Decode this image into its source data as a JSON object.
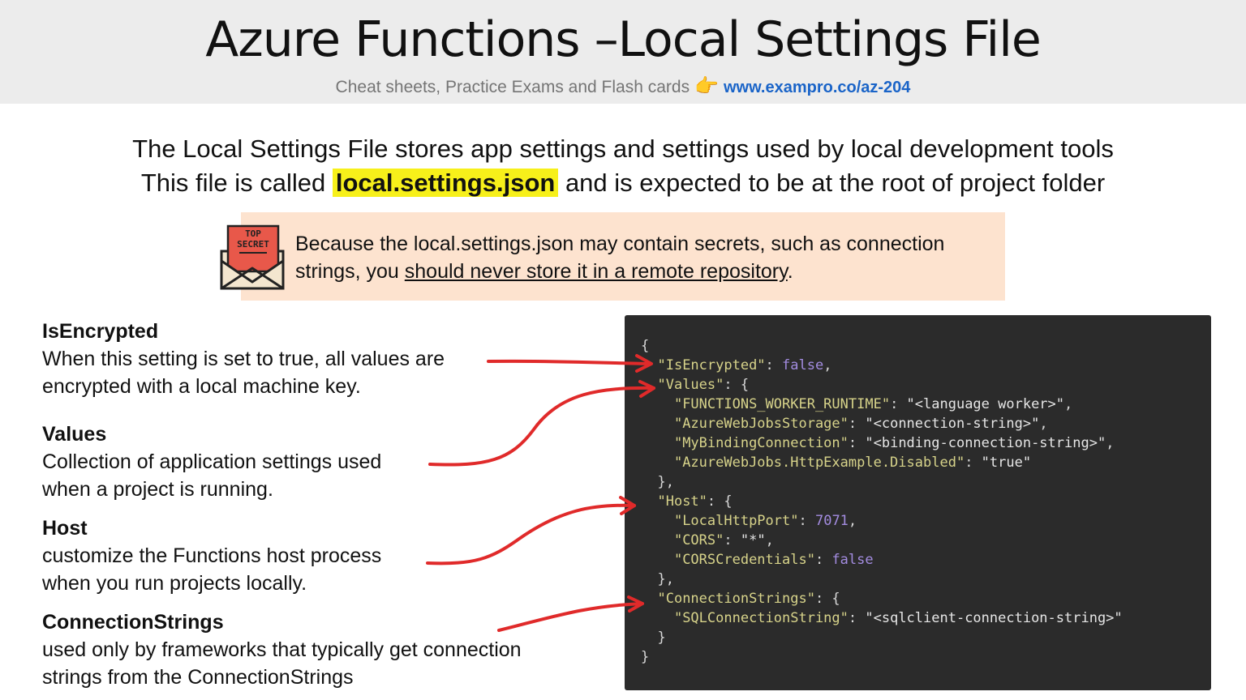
{
  "header": {
    "title": "Azure Functions –Local Settings File",
    "subtitle": "Cheat sheets, Practice Exams and Flash cards",
    "hand": "👉",
    "link": "www.exampro.co/az-204"
  },
  "intro": {
    "line1": "The Local Settings File stores app settings and settings used by local development tools",
    "line2_before": "This file is called ",
    "line2_highlight": "local.settings.json",
    "line2_after": " and is expected to be at the root of project folder"
  },
  "warning": {
    "icon_label_top": "TOP",
    "icon_label_bottom": "SECRET",
    "text_before": "Because the local.settings.json may contain secrets, such as connection strings, you ",
    "text_underlined": "should never store it in a remote repository",
    "text_after": "."
  },
  "definitions": [
    {
      "term": "IsEncrypted",
      "line1": "When this setting is set to true, all values are",
      "line2": "encrypted with a local machine key."
    },
    {
      "term": "Values",
      "line1": "Collection of application settings used",
      "line2": "when a project is running."
    },
    {
      "term": "Host",
      "line1": "customize the Functions host process",
      "line2": "when you run projects locally."
    },
    {
      "term": "ConnectionStrings",
      "line1": "used only by frameworks that typically get connection",
      "line2": "strings from the ConnectionStrings"
    }
  ],
  "code": {
    "open_brace": "{",
    "close_brace": "}",
    "is_encrypted_key": "\"IsEncrypted\"",
    "is_encrypted_value": "false",
    "values_key": "\"Values\"",
    "worker_runtime_key": "\"FUNCTIONS_WORKER_RUNTIME\"",
    "worker_runtime_value": "\"<language worker>\"",
    "webjobs_storage_key": "\"AzureWebJobsStorage\"",
    "webjobs_storage_value": "\"<connection-string>\"",
    "binding_key": "\"MyBindingConnection\"",
    "binding_value": "\"<binding-connection-string>\"",
    "disabled_key": "\"AzureWebJobs.HttpExample.Disabled\"",
    "disabled_value": "\"true\"",
    "host_key": "\"Host\"",
    "port_key": "\"LocalHttpPort\"",
    "port_value": "7071",
    "cors_key": "\"CORS\"",
    "cors_value": "\"*\"",
    "cors_credentials_key": "\"CORSCredentials\"",
    "cors_credentials_value": "false",
    "connection_strings_key": "\"ConnectionStrings\"",
    "sql_key": "\"SQLConnectionString\"",
    "sql_value": "\"<sqlclient-connection-string>\""
  },
  "colors": {
    "header_bg": "#ececec",
    "highlight": "#f7f01a",
    "warning_bg": "#fde3cf",
    "code_bg": "#2b2b2b",
    "code_key": "#d7d38a",
    "code_number": "#a38ce0",
    "arrow": "#e02a2a",
    "link": "#1a64c8"
  }
}
